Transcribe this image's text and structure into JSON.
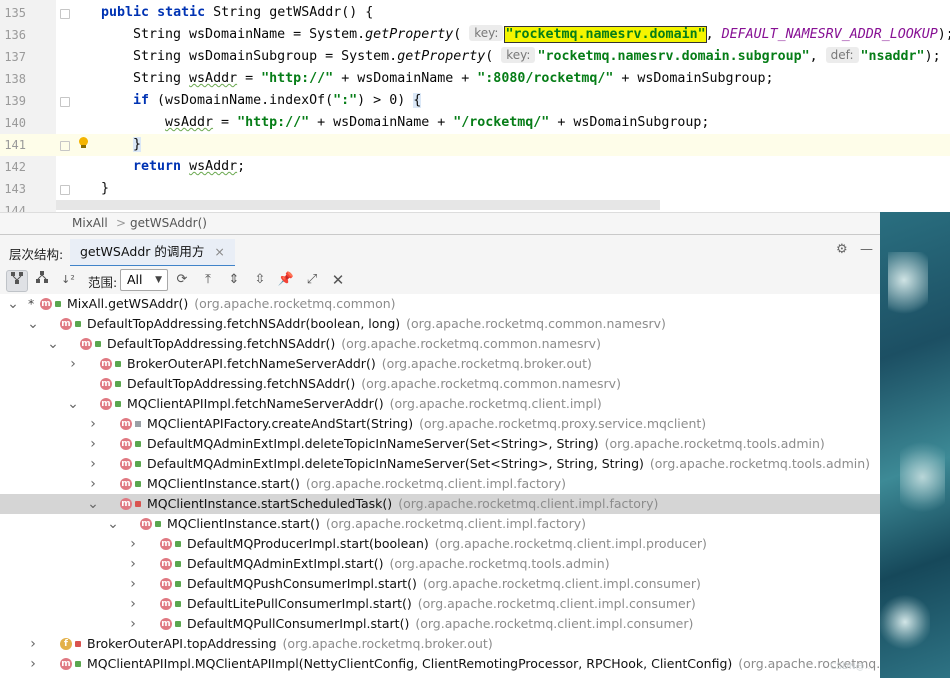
{
  "editor": {
    "lines": [
      {
        "num": "135",
        "indent": 0
      },
      {
        "num": "136",
        "indent": 1,
        "hint1": "key:",
        "str1": "\"rocketmq.namesrv.domain\"",
        "const": "DEFAULT_NAMESRV_ADDR_LOOKUP"
      },
      {
        "num": "137",
        "indent": 1,
        "hint1": "key:",
        "str1": "\"rocketmq.namesrv.domain.subgroup\"",
        "hint2": "def:",
        "str2": "\"nsaddr\""
      },
      {
        "num": "138",
        "indent": 1,
        "str1": "\"http://\"",
        "str2": "\":8080/rocketmq/\""
      },
      {
        "num": "139",
        "indent": 1,
        "str1": "\":\""
      },
      {
        "num": "140",
        "indent": 2,
        "str1": "\"http://\"",
        "str2": "\"/rocketmq/\""
      },
      {
        "num": "141",
        "indent": 1
      },
      {
        "num": "142",
        "indent": 1
      },
      {
        "num": "143",
        "indent": 0
      },
      {
        "num": "144",
        "indent": 0
      }
    ],
    "tokens": {
      "public": "public",
      "static": "static",
      "string_type": "String",
      "method_sig": "getWSAddr() {",
      "l136_a": "String wsDomainName = System.",
      "getProperty": "getProperty",
      "paren": "(",
      "l136_b": ", ",
      "l136_c": ");",
      "l137_a": "String wsDomainSubgroup = System.",
      "l137_b": ", ",
      "l137_c": ");",
      "l138_a": "String ",
      "wsAddr": "wsAddr",
      "l138_b": " = ",
      "l138_c": " + wsDomainName + ",
      "l138_d": " + wsDomainSubgroup;",
      "if": "if",
      "l139_a": " (wsDomainName.indexOf(",
      "l139_b": ") > 0) ",
      "open_brace": "{",
      "l140_b": " = ",
      "l140_c": " + wsDomainName + ",
      "l140_d": " + wsDomainSubgroup;",
      "close_brace": "}",
      "return": "return",
      "l142_b": ";",
      "method_close": "}"
    }
  },
  "breadcrumb": {
    "items": [
      "MixAll",
      "getWSAddr()"
    ],
    "separator": ">"
  },
  "hierarchy_panel": {
    "label": "层次结构:",
    "tab_title": "getWSAddr 的调用方",
    "tab_close": "×",
    "scope_label": "范围:",
    "scope_value": "All",
    "right_buttons": [
      "⚙",
      "—"
    ]
  },
  "tree": {
    "rows": [
      {
        "level": 0,
        "chevron": "v",
        "star": "*",
        "kind": "m",
        "vis": "pub",
        "name": "MixAll.getWSAddr()",
        "pkg": "(org.apache.rocketmq.common)"
      },
      {
        "level": 1,
        "chevron": "v",
        "kind": "m",
        "vis": "pub",
        "name": "DefaultTopAddressing.fetchNSAddr(boolean, long)",
        "pkg": "(org.apache.rocketmq.common.namesrv)"
      },
      {
        "level": 2,
        "chevron": "v",
        "kind": "m",
        "vis": "pub",
        "name": "DefaultTopAddressing.fetchNSAddr()",
        "pkg": "(org.apache.rocketmq.common.namesrv)"
      },
      {
        "level": 3,
        "chevron": ">",
        "kind": "m",
        "vis": "pub",
        "name": "BrokerOuterAPI.fetchNameServerAddr()",
        "pkg": "(org.apache.rocketmq.broker.out)"
      },
      {
        "level": 3,
        "chevron": "",
        "kind": "m",
        "vis": "pub",
        "name": "DefaultTopAddressing.fetchNSAddr()",
        "pkg": "(org.apache.rocketmq.common.namesrv)"
      },
      {
        "level": 3,
        "chevron": "v",
        "kind": "m",
        "vis": "pub",
        "name": "MQClientAPIImpl.fetchNameServerAddr()",
        "pkg": "(org.apache.rocketmq.client.impl)"
      },
      {
        "level": 4,
        "chevron": ">",
        "kind": "m",
        "vis": "pkg",
        "name": "MQClientAPIFactory.createAndStart(String)",
        "pkg": "(org.apache.rocketmq.proxy.service.mqclient)"
      },
      {
        "level": 4,
        "chevron": ">",
        "kind": "m",
        "vis": "pub",
        "name": "DefaultMQAdminExtImpl.deleteTopicInNameServer(Set<String>, String)",
        "pkg": "(org.apache.rocketmq.tools.admin)"
      },
      {
        "level": 4,
        "chevron": ">",
        "kind": "m",
        "vis": "pub",
        "name": "DefaultMQAdminExtImpl.deleteTopicInNameServer(Set<String>, String, String)",
        "pkg": "(org.apache.rocketmq.tools.admin)"
      },
      {
        "level": 4,
        "chevron": ">",
        "kind": "m",
        "vis": "pub",
        "name": "MQClientInstance.start()",
        "pkg": "(org.apache.rocketmq.client.impl.factory)"
      },
      {
        "level": 4,
        "chevron": "v",
        "kind": "m",
        "vis": "lock",
        "name": "MQClientInstance.startScheduledTask()",
        "pkg": "(org.apache.rocketmq.client.impl.factory)",
        "selected": true
      },
      {
        "level": 5,
        "chevron": "v",
        "kind": "m",
        "vis": "pub",
        "name": "MQClientInstance.start()",
        "pkg": "(org.apache.rocketmq.client.impl.factory)"
      },
      {
        "level": 6,
        "chevron": ">",
        "kind": "m",
        "vis": "pub",
        "name": "DefaultMQProducerImpl.start(boolean)",
        "pkg": "(org.apache.rocketmq.client.impl.producer)"
      },
      {
        "level": 6,
        "chevron": ">",
        "kind": "m",
        "vis": "pub",
        "name": "DefaultMQAdminExtImpl.start()",
        "pkg": "(org.apache.rocketmq.tools.admin)"
      },
      {
        "level": 6,
        "chevron": ">",
        "kind": "m",
        "vis": "pub",
        "name": "DefaultMQPushConsumerImpl.start()",
        "pkg": "(org.apache.rocketmq.client.impl.consumer)"
      },
      {
        "level": 6,
        "chevron": ">",
        "kind": "m",
        "vis": "pub",
        "name": "DefaultLitePullConsumerImpl.start()",
        "pkg": "(org.apache.rocketmq.client.impl.consumer)"
      },
      {
        "level": 6,
        "chevron": ">",
        "kind": "m",
        "vis": "pub",
        "name": "DefaultMQPullConsumerImpl.start()",
        "pkg": "(org.apache.rocketmq.client.impl.consumer)"
      },
      {
        "level": 1,
        "chevron": ">",
        "kind": "f",
        "vis": "lock",
        "name": "BrokerOuterAPI.topAddressing",
        "pkg": "(org.apache.rocketmq.broker.out)"
      },
      {
        "level": 1,
        "chevron": ">",
        "kind": "m",
        "vis": "pub",
        "name": "MQClientAPIImpl.MQClientAPIImpl(NettyClientConfig, ClientRemotingProcessor, RPCHook, ClientConfig)",
        "pkg": "(org.apache.rocketmq.client.impl"
      }
    ]
  },
  "colors": {
    "keyword": "#0033b3",
    "string": "#067d17",
    "constant": "#871094",
    "highlight": "#f5f500",
    "selection_row": "#d5d5d5",
    "tab_underline": "#4083c9",
    "method_badge": "#e07a83",
    "field_badge": "#e3b14a"
  },
  "icons": [
    "hierarchy-icon",
    "subtypes-icon",
    "sort-icon",
    "refresh-icon",
    "export-icon",
    "expand-all-icon",
    "collapse-all-icon",
    "pin-icon",
    "open-icon",
    "close-icon",
    "lightbulb-icon",
    "gear-icon",
    "minimize-icon"
  ],
  "watermark": "CSDN@..."
}
